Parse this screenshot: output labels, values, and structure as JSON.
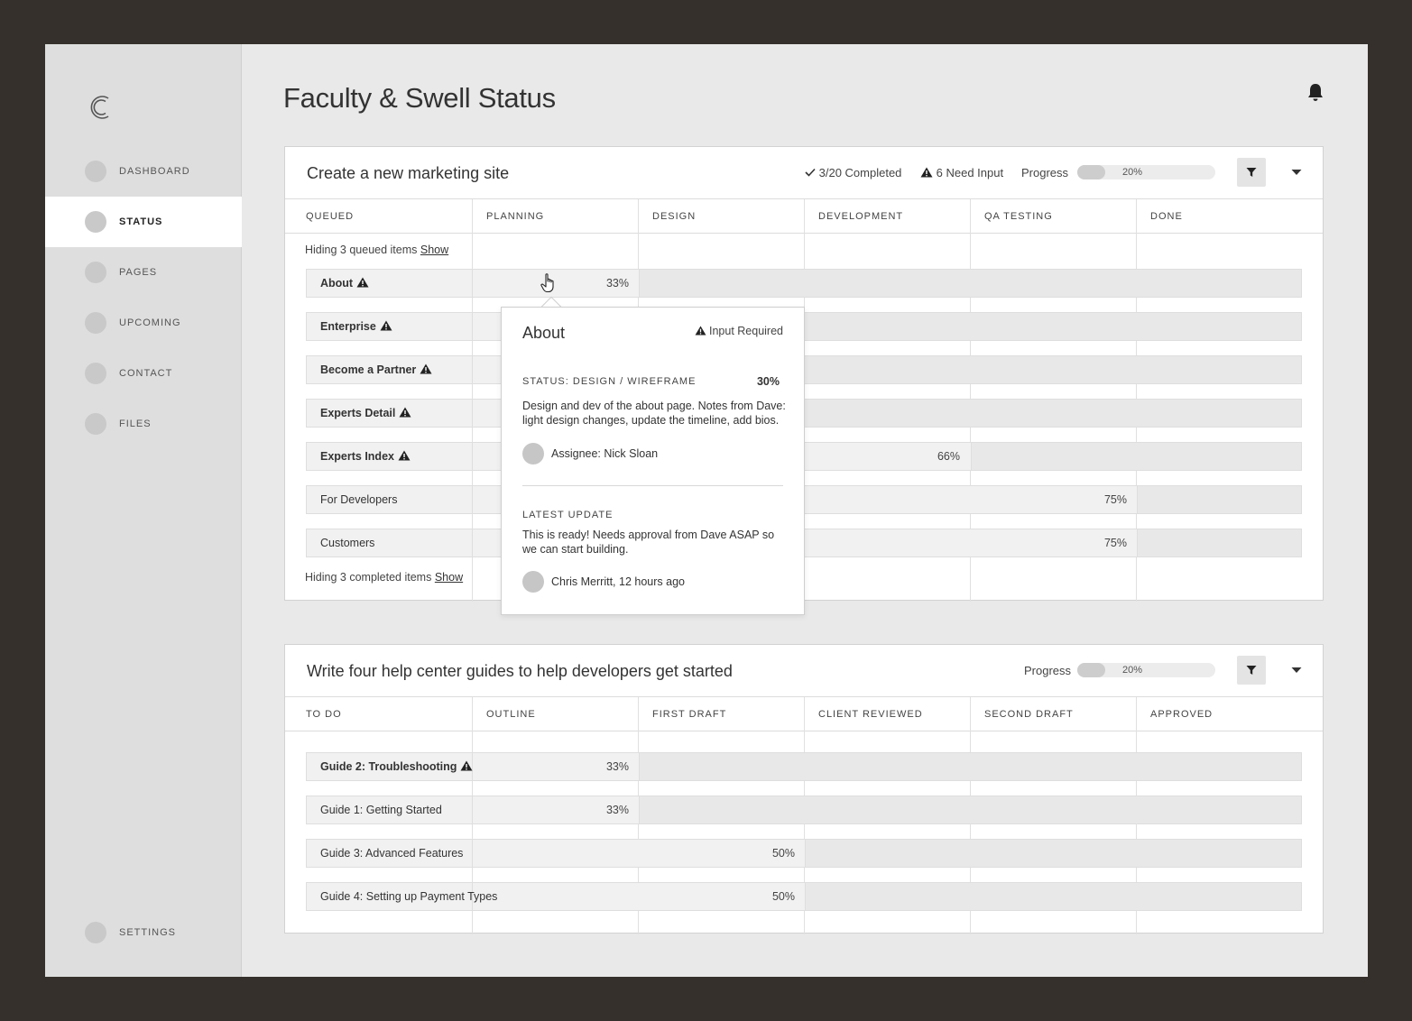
{
  "sidebar": {
    "logo": "C",
    "items": [
      {
        "label": "DASHBOARD",
        "icon": "circle-icon"
      },
      {
        "label": "STATUS",
        "icon": "circle-icon",
        "active": true
      },
      {
        "label": "PAGES",
        "icon": "circle-icon"
      },
      {
        "label": "UPCOMING",
        "icon": "circle-icon"
      },
      {
        "label": "CONTACT",
        "icon": "circle-icon"
      },
      {
        "label": "FILES",
        "icon": "circle-icon"
      }
    ],
    "settings": {
      "label": "SETTINGS",
      "icon": "circle-icon"
    }
  },
  "header": {
    "title": "Faculty & Swell Status",
    "bell_icon": "bell-icon"
  },
  "project1": {
    "title": "Create a new marketing site",
    "completed": "3/20 Completed",
    "need_input": "6 Need Input",
    "progress_label": "Progress",
    "progress_pct": "20%",
    "progress_value": 20,
    "columns": [
      "QUEUED",
      "PLANNING",
      "DESIGN",
      "DEVELOPMENT",
      "QA TESTING",
      "DONE"
    ],
    "hiding_queued": "Hiding 3 queued items",
    "hiding_completed": "Hiding 3 completed items",
    "show_label": "Show",
    "rows": [
      {
        "name": "About",
        "warning": true,
        "pct": "33%"
      },
      {
        "name": "Enterprise",
        "warning": true,
        "pct": ""
      },
      {
        "name": "Become a Partner",
        "warning": true,
        "pct": ""
      },
      {
        "name": "Experts Detail",
        "warning": true,
        "pct": ""
      },
      {
        "name": "Experts Index",
        "warning": true,
        "pct": "66%"
      },
      {
        "name": "For Developers",
        "warning": false,
        "pct": "75%"
      },
      {
        "name": "Customers",
        "warning": false,
        "pct": "75%"
      }
    ]
  },
  "popover": {
    "title": "About",
    "flag": "Input Required",
    "status": "STATUS: DESIGN / WIREFRAME",
    "status_pct": "30%",
    "description": "Design and dev of the about page. Notes from Dave: light design changes, update the timeline, add  bios.",
    "assignee": "Assignee: Nick Sloan",
    "latest_label": "LATEST UPDATE",
    "latest_text": "This is ready! Needs approval from Dave ASAP so we can start building.",
    "latest_author": "Chris Merritt, 12 hours ago"
  },
  "project2": {
    "title": "Write four help center guides to help developers get started",
    "progress_label": "Progress",
    "progress_pct": "20%",
    "progress_value": 20,
    "columns": [
      "TO DO",
      "OUTLINE",
      "FIRST DRAFT",
      "CLIENT REVIEWED",
      "SECOND DRAFT",
      "APPROVED"
    ],
    "rows": [
      {
        "name": "Guide 2: Troubleshooting",
        "warning": true,
        "pct": "33%"
      },
      {
        "name": "Guide 1: Getting Started",
        "warning": false,
        "pct": "33%"
      },
      {
        "name": "Guide 3: Advanced Features",
        "warning": false,
        "pct": "50%"
      },
      {
        "name": "Guide 4: Setting up Payment Types",
        "warning": false,
        "pct": "50%"
      }
    ]
  }
}
